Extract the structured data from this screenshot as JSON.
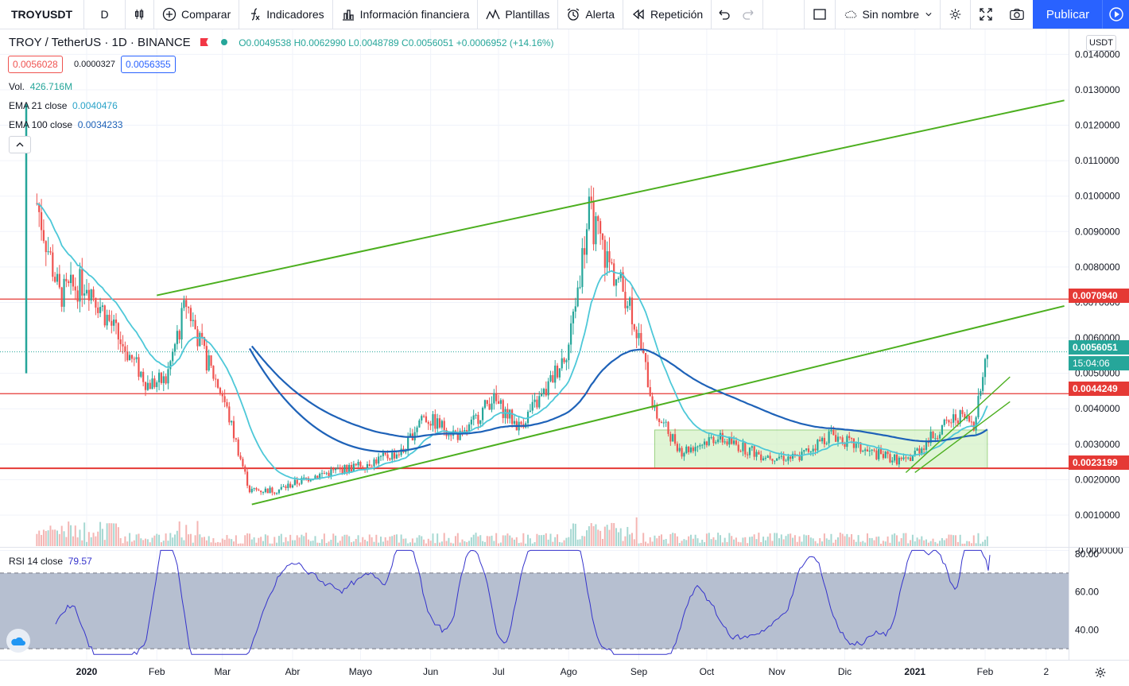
{
  "toolbar": {
    "symbol": "TROYUSDT",
    "interval": "D",
    "compare": "Comparar",
    "indicators": "Indicadores",
    "financials": "Información financiera",
    "templates": "Plantillas",
    "alert": "Alerta",
    "replay": "Repetición",
    "layout_name": "Sin nombre",
    "publish": "Publicar"
  },
  "legend": {
    "title": "TROY / TetherUS · 1D · BINANCE",
    "ohlc": "O0.0049538 H0.0062990 L0.0048789 C0.0056051 +0.0006952 (+14.16%)",
    "bid": "0.0056028",
    "spread": "0.0000327",
    "ask": "0.0056355",
    "vol_label": "Vol.",
    "vol_value": "426.716M",
    "ema21_label": "EMA 21 close",
    "ema21_value": "0.0040476",
    "ema100_label": "EMA 100 close",
    "ema100_value": "0.0034233",
    "rsi_label": "RSI 14 close",
    "rsi_value": "79.57"
  },
  "axis": {
    "currency": "USDT",
    "last_price": "0.0056051",
    "countdown": "15:04:06",
    "level_high": "0.0070940",
    "level_mid": "0.0044249",
    "level_low": "0.0023199"
  },
  "colors": {
    "up": "#26a69a",
    "down": "#ef5350",
    "ema21": "#4dc8d8",
    "ema100": "#1e62b8",
    "trend": "#4caf1f",
    "level": "#e53935",
    "rsi": "#3533cc",
    "rsi_band": "#b2bccd"
  },
  "chart_data": [
    {
      "type": "candlestick",
      "title": "TROY / TetherUS · 1D · BINANCE",
      "x_ticks": [
        "2020",
        "Feb",
        "Mar",
        "Abr",
        "Mayo",
        "Jun",
        "Jul",
        "Ago",
        "Sep",
        "Oct",
        "Nov",
        "Dic",
        "2021",
        "Feb",
        "2"
      ],
      "y_ticks": [
        "0.0140000",
        "0.0130000",
        "0.0120000",
        "0.0110000",
        "0.0100000",
        "0.0090000",
        "0.0080000",
        "0.0070000",
        "0.0060000",
        "0.0050000",
        "0.0040000",
        "0.0030000",
        "0.0020000",
        "0.0010000",
        "-0.0000000"
      ],
      "ylim": [
        -0.0001,
        0.0143
      ],
      "approx_close_series": [
        [
          "2019-12-10",
          0.0098
        ],
        [
          "2019-12-20",
          0.0072
        ],
        [
          "2020-01-01",
          0.0076
        ],
        [
          "2020-01-15",
          0.006
        ],
        [
          "2020-01-28",
          0.0047
        ],
        [
          "2020-02-05",
          0.0048
        ],
        [
          "2020-02-14",
          0.007
        ],
        [
          "2020-02-22",
          0.0055
        ],
        [
          "2020-03-01",
          0.0044
        ],
        [
          "2020-03-13",
          0.0017
        ],
        [
          "2020-03-25",
          0.0017
        ],
        [
          "2020-04-10",
          0.0021
        ],
        [
          "2020-05-01",
          0.0024
        ],
        [
          "2020-05-20",
          0.0028
        ],
        [
          "2020-05-28",
          0.0038
        ],
        [
          "2020-06-15",
          0.0032
        ],
        [
          "2020-06-28",
          0.0043
        ],
        [
          "2020-07-10",
          0.0035
        ],
        [
          "2020-07-22",
          0.0045
        ],
        [
          "2020-08-01",
          0.0058
        ],
        [
          "2020-08-10",
          0.0095
        ],
        [
          "2020-08-18",
          0.0082
        ],
        [
          "2020-08-28",
          0.007
        ],
        [
          "2020-09-02",
          0.0057
        ],
        [
          "2020-09-08",
          0.0039
        ],
        [
          "2020-09-20",
          0.0028
        ],
        [
          "2020-10-05",
          0.0032
        ],
        [
          "2020-10-25",
          0.0027
        ],
        [
          "2020-11-10",
          0.0026
        ],
        [
          "2020-11-25",
          0.0033
        ],
        [
          "2020-12-10",
          0.0028
        ],
        [
          "2020-12-28",
          0.0025
        ],
        [
          "2021-01-10",
          0.0033
        ],
        [
          "2021-01-20",
          0.0038
        ],
        [
          "2021-01-27",
          0.0036
        ],
        [
          "2021-02-02",
          0.0056
        ]
      ],
      "horizontal_levels": [
        0.007094,
        0.0044249,
        0.0023199
      ],
      "last_close": 0.0056051,
      "indicators": [
        "EMA 21 close 0.0040476",
        "EMA 100 close 0.0034233"
      ]
    },
    {
      "type": "line",
      "title": "RSI 14 close",
      "y_ticks": [
        "80.00",
        "60.00",
        "40.00"
      ],
      "band": [
        30,
        70
      ],
      "last_value": 79.57
    }
  ]
}
